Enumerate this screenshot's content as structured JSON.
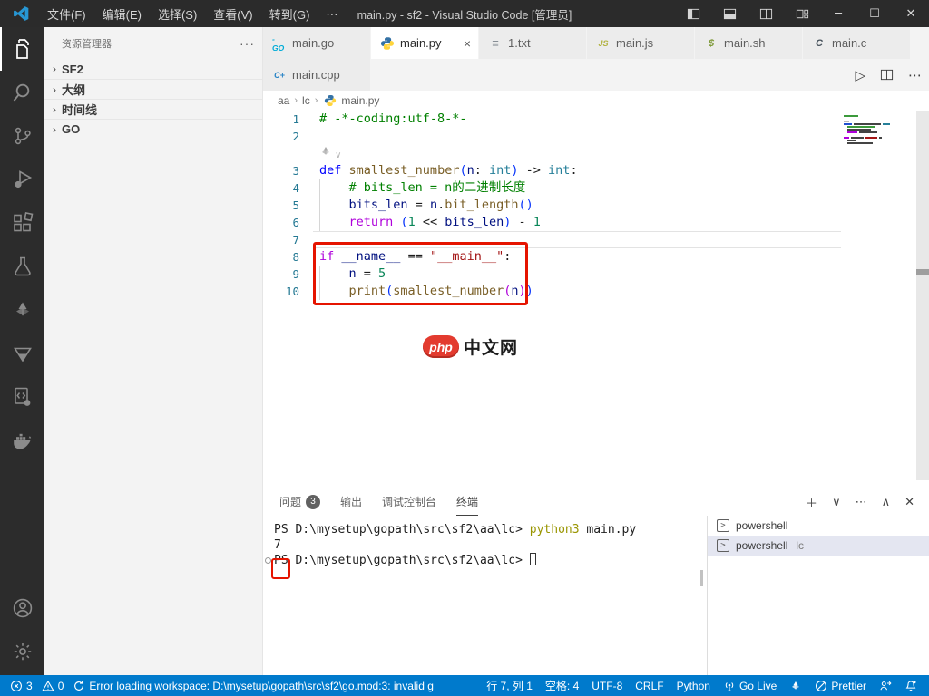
{
  "title_bar": {
    "menus": [
      "文件(F)",
      "编辑(E)",
      "选择(S)",
      "查看(V)",
      "转到(G)",
      "···"
    ],
    "title": "main.py - sf2 - Visual Studio Code [管理员]",
    "window_controls": [
      {
        "name": "toggle-sidebar-icon",
        "icon": "layout-sidebar"
      },
      {
        "name": "toggle-panel-icon",
        "icon": "layout-panel"
      },
      {
        "name": "toggle-secondary-sidebar-icon",
        "icon": "layout-split"
      },
      {
        "name": "customize-layout-icon",
        "icon": "layout-custom"
      },
      {
        "name": "minimize-button",
        "glyph": "─"
      },
      {
        "name": "maximize-button",
        "glyph": "☐"
      },
      {
        "name": "close-button",
        "glyph": "✕"
      }
    ]
  },
  "activity_bar": {
    "top": [
      {
        "name": "explorer",
        "active": true
      },
      {
        "name": "search"
      },
      {
        "name": "source-control"
      },
      {
        "name": "run-debug"
      },
      {
        "name": "extensions"
      },
      {
        "name": "testing"
      },
      {
        "name": "pinwheel"
      },
      {
        "name": "triangle"
      },
      {
        "name": "code-runner"
      },
      {
        "name": "docker"
      }
    ],
    "bottom": [
      {
        "name": "account"
      },
      {
        "name": "settings"
      }
    ]
  },
  "sidebar": {
    "header": "资源管理器",
    "more_glyph": "···",
    "chevron": "›",
    "sections": [
      {
        "label": "SF2"
      },
      {
        "label": "大纲"
      },
      {
        "label": "时间线"
      },
      {
        "label": "GO"
      }
    ]
  },
  "editor_tabs": {
    "row1": [
      {
        "label": "main.go",
        "icon": "go"
      },
      {
        "label": "main.py",
        "icon": "py",
        "active": true,
        "close": "×"
      },
      {
        "label": "1.txt",
        "icon": "txt"
      },
      {
        "label": "main.js",
        "icon": "js"
      },
      {
        "label": "main.sh",
        "icon": "sh"
      },
      {
        "label": "main.c",
        "icon": "c"
      }
    ],
    "row2": [
      {
        "label": "main.cpp",
        "icon": "cpp"
      }
    ],
    "actions": [
      {
        "name": "run-button",
        "glyph": "▷"
      },
      {
        "name": "split-editor-button",
        "icon": "split"
      },
      {
        "name": "more-actions-button",
        "glyph": "⋯"
      }
    ]
  },
  "breadcrumb": {
    "items": [
      "aa",
      "lc"
    ],
    "separator": "›",
    "file": "main.py"
  },
  "editor": {
    "lines": [
      {
        "num": "1",
        "tokens": [
          [
            "# -*-coding:utf-8-*-",
            "comment"
          ]
        ]
      },
      {
        "num": "2",
        "tokens": []
      },
      {
        "lens": true,
        "tokens": []
      },
      {
        "num": "3",
        "tokens": [
          [
            "def",
            "kw"
          ],
          [
            " ",
            "pl"
          ],
          [
            "smallest_number",
            "fn"
          ],
          [
            "(",
            "pa"
          ],
          [
            "n",
            "va"
          ],
          [
            ": ",
            "pl"
          ],
          [
            "int",
            "ty"
          ],
          [
            ")",
            "pa"
          ],
          [
            " -> ",
            "pl"
          ],
          [
            "int",
            "ty"
          ],
          [
            ":",
            "pl"
          ]
        ]
      },
      {
        "num": "4",
        "guide": true,
        "tokens": [
          [
            "    # bits_len = n的二进制长度",
            "comment"
          ]
        ]
      },
      {
        "num": "5",
        "guide": true,
        "tokens": [
          [
            "    ",
            "pl"
          ],
          [
            "bits_len",
            "va"
          ],
          [
            " = ",
            "pl"
          ],
          [
            "n",
            "va"
          ],
          [
            ".",
            "pl"
          ],
          [
            "bit_length",
            "fn"
          ],
          [
            "()",
            "pa"
          ]
        ]
      },
      {
        "num": "6",
        "guide": true,
        "tokens": [
          [
            "    ",
            "pl"
          ],
          [
            "return",
            "ct"
          ],
          [
            " ",
            "pl"
          ],
          [
            "(",
            "pa"
          ],
          [
            "1",
            "nu"
          ],
          [
            " << ",
            "pl"
          ],
          [
            "bits_len",
            "va"
          ],
          [
            ")",
            "pa"
          ],
          [
            " - ",
            "pl"
          ],
          [
            "1",
            "nu"
          ]
        ]
      },
      {
        "num": "7",
        "current": true,
        "tokens": []
      },
      {
        "num": "8",
        "tokens": [
          [
            "if",
            "ct"
          ],
          [
            " ",
            "pl"
          ],
          [
            "__name__",
            "va"
          ],
          [
            " == ",
            "pl"
          ],
          [
            "\"__main__\"",
            "st"
          ],
          [
            ":",
            "pl"
          ]
        ]
      },
      {
        "num": "9",
        "guide": true,
        "tokens": [
          [
            "    ",
            "pl"
          ],
          [
            "n",
            "va"
          ],
          [
            " = ",
            "pl"
          ],
          [
            "5",
            "nu"
          ]
        ]
      },
      {
        "num": "10",
        "guide": true,
        "tokens": [
          [
            "    ",
            "pl"
          ],
          [
            "print",
            "fn"
          ],
          [
            "(",
            "pa"
          ],
          [
            "smallest_number",
            "fn"
          ],
          [
            "(",
            "pa2"
          ],
          [
            "n",
            "va"
          ],
          [
            ")",
            "pa2"
          ],
          [
            ")",
            "pa"
          ]
        ]
      }
    ],
    "minimap": [
      {
        "ml": 0,
        "segs": [
          [
            16,
            "#3c9a3c"
          ]
        ]
      },
      {
        "ml": 0,
        "segs": []
      },
      {
        "ml": 0,
        "segs": [
          [
            6,
            "#bbbbbb"
          ]
        ]
      },
      {
        "ml": 0,
        "segs": [
          [
            9,
            "#2050d0"
          ],
          [
            30,
            "#444444"
          ],
          [
            8,
            "#267f99"
          ]
        ]
      },
      {
        "ml": 4,
        "segs": [
          [
            30,
            "#3c9a3c"
          ]
        ]
      },
      {
        "ml": 4,
        "segs": [
          [
            26,
            "#444444"
          ]
        ]
      },
      {
        "ml": 4,
        "segs": [
          [
            11,
            "#af00db"
          ],
          [
            20,
            "#444444"
          ]
        ]
      },
      {
        "ml": 0,
        "segs": []
      },
      {
        "ml": 0,
        "segs": [
          [
            6,
            "#af00db"
          ],
          [
            14,
            "#444444"
          ],
          [
            13,
            "#a31515"
          ],
          [
            3,
            "#444444"
          ]
        ]
      },
      {
        "ml": 4,
        "segs": [
          [
            10,
            "#444444"
          ]
        ]
      },
      {
        "ml": 4,
        "segs": [
          [
            28,
            "#444444"
          ]
        ]
      }
    ]
  },
  "watermark": {
    "badge": "php",
    "text": "中文网"
  },
  "panel": {
    "tabs": [
      {
        "label": "问题",
        "badge": "3"
      },
      {
        "label": "输出"
      },
      {
        "label": "调试控制台"
      },
      {
        "label": "终端",
        "active": true
      }
    ],
    "actions": [
      {
        "name": "new-terminal-button",
        "glyph": "＋"
      },
      {
        "name": "terminal-dropdown-button",
        "glyph": "∨"
      },
      {
        "name": "panel-more-button",
        "glyph": "⋯"
      },
      {
        "name": "panel-maximize-button",
        "glyph": "∧"
      },
      {
        "name": "panel-close-button",
        "glyph": "✕"
      }
    ],
    "terminal_lines": [
      {
        "tokens": [
          [
            "PS D:\\mysetup\\gopath\\src\\sf2\\aa\\lc> ",
            "pl"
          ],
          [
            "python3",
            "cmd"
          ],
          [
            " main.py",
            "pl"
          ]
        ]
      },
      {
        "annotated": true,
        "tokens": [
          [
            "7",
            "pl"
          ]
        ]
      },
      {
        "decoration": true,
        "cursor": true,
        "tokens": [
          [
            "PS D:\\mysetup\\gopath\\src\\sf2\\aa\\lc> ",
            "pl"
          ]
        ]
      }
    ],
    "terminal_list": [
      {
        "label": "powershell",
        "icon_glyph": ">"
      },
      {
        "label": "powershell",
        "desc": "lc",
        "icon_glyph": ">",
        "selected": true
      }
    ]
  },
  "status_bar": {
    "left": [
      {
        "name": "problems-errors",
        "icon": "error",
        "text": "3"
      },
      {
        "name": "problems-warnings",
        "icon": "warning",
        "text": "0"
      },
      {
        "name": "workspace-error-message",
        "icon": "sync",
        "text": "Error loading workspace: D:\\mysetup\\gopath\\src\\sf2\\go.mod:3: invalid g"
      }
    ],
    "right": [
      {
        "name": "cursor-position",
        "text": "行 7, 列 1"
      },
      {
        "name": "indentation",
        "text": "空格: 4"
      },
      {
        "name": "encoding",
        "text": "UTF-8"
      },
      {
        "name": "eol",
        "text": "CRLF"
      },
      {
        "name": "language-mode",
        "text": "Python"
      },
      {
        "name": "go-live",
        "icon": "broadcast",
        "text": "Go Live"
      },
      {
        "name": "extension-pinwheel",
        "icon": "pinwheel-sm",
        "text": ""
      },
      {
        "name": "prettier",
        "icon": "slash",
        "text": "Prettier"
      },
      {
        "name": "feedback",
        "icon": "feedback",
        "text": ""
      },
      {
        "name": "notifications-bell",
        "icon": "bell",
        "text": ""
      }
    ]
  },
  "colors": {
    "accent": "#007acc",
    "annotation": "#e51400",
    "titlebar": "#2b2b2b",
    "activitybar": "#2c2c2c",
    "sidebar": "#f3f3f3"
  }
}
